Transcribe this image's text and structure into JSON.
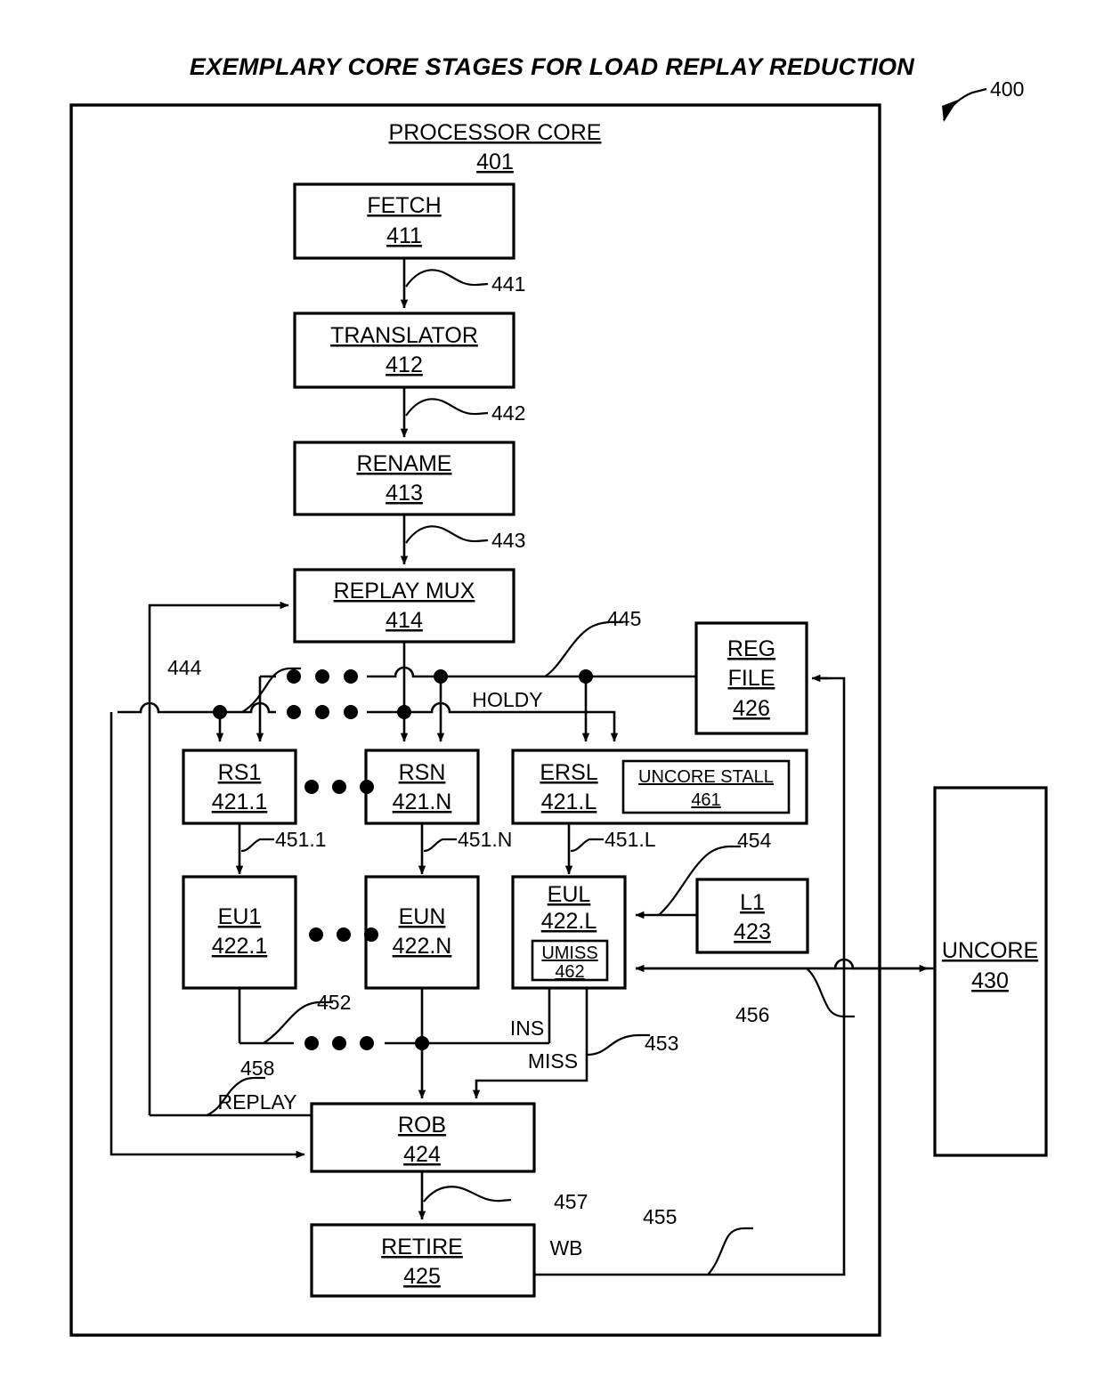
{
  "figure": {
    "title": "EXEMPLARY CORE STAGES FOR LOAD REPLAY REDUCTION",
    "figure_ref": "400"
  },
  "container": {
    "label": "PROCESSOR CORE",
    "ref": "401"
  },
  "blocks": {
    "fetch": {
      "label": "FETCH",
      "ref": "411"
    },
    "translator": {
      "label": "TRANSLATOR",
      "ref": "412"
    },
    "rename": {
      "label": "RENAME",
      "ref": "413"
    },
    "replay_mux": {
      "label": "REPLAY MUX",
      "ref": "414"
    },
    "reg_file_l1": {
      "label": "REG",
      "label2": "FILE",
      "ref": "426"
    },
    "rs1": {
      "label": "RS1",
      "ref": "421.1"
    },
    "rsn": {
      "label": "RSN",
      "ref": "421.N"
    },
    "ersl": {
      "label": "ERSL",
      "ref": "421.L"
    },
    "uncore_stall": {
      "label": "UNCORE STALL",
      "ref": "461"
    },
    "eu1": {
      "label": "EU1",
      "ref": "422.1"
    },
    "eun": {
      "label": "EUN",
      "ref": "422.N"
    },
    "eul": {
      "label": "EUL",
      "ref": "422.L"
    },
    "umiss": {
      "label": "UMISS",
      "ref": "462"
    },
    "l1": {
      "label": "L1",
      "ref": "423"
    },
    "rob": {
      "label": "ROB",
      "ref": "424"
    },
    "retire": {
      "label": "RETIRE",
      "ref": "425"
    },
    "uncore": {
      "label": "UNCORE",
      "ref": "430"
    }
  },
  "connector_refs": {
    "c441": "441",
    "c442": "442",
    "c443": "443",
    "c444": "444",
    "c445": "445",
    "c451_1": "451.1",
    "c451_n": "451.N",
    "c451_l": "451.L",
    "c452": "452",
    "c453": "453",
    "c454": "454",
    "c455": "455",
    "c456": "456",
    "c457": "457",
    "c458": "458"
  },
  "signal_labels": {
    "holdy": "HOLDY",
    "ins": "INS",
    "miss": "MISS",
    "replay": "REPLAY",
    "wb": "WB"
  }
}
